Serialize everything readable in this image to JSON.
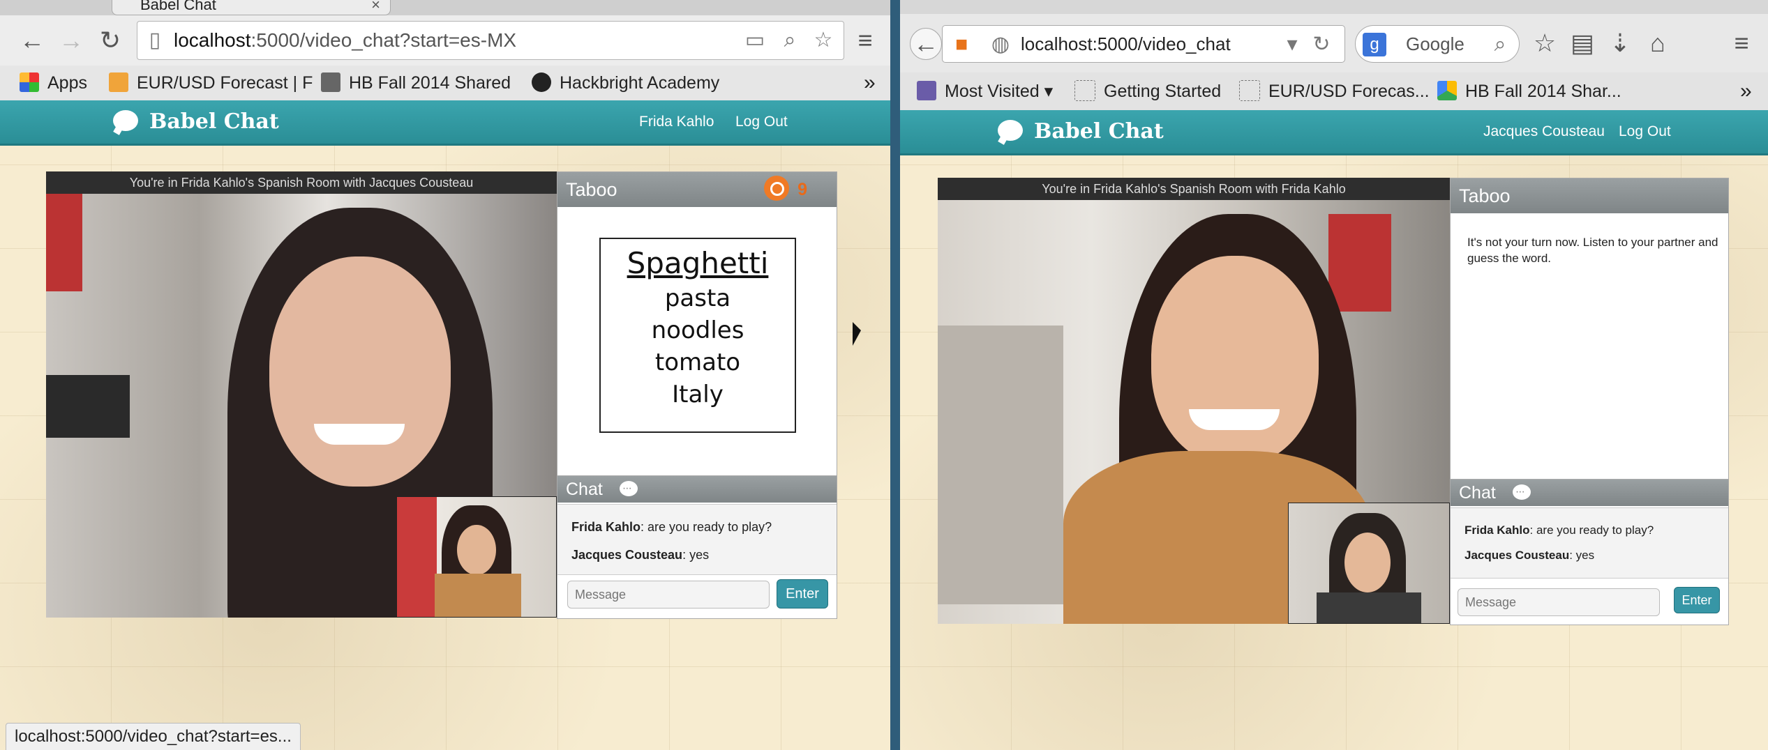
{
  "left": {
    "tab_title": "Babel Chat",
    "url_host": "localhost",
    "url_path": ":5000/video_chat?start=es-MX",
    "bookmarks": [
      "Apps",
      "EUR/USD Forecast | F",
      "HB Fall 2014 Shared",
      "Hackbright Academy"
    ],
    "bookmarks_overflow": "»",
    "app": {
      "logo": "Babel Chat",
      "user": "Frida Kahlo",
      "logout": "Log Out",
      "caption": "You're in Frida Kahlo's Spanish Room with Jacques Cousteau",
      "game_title": "Taboo",
      "timer": "9",
      "card": {
        "target": "Spaghetti",
        "taboo": [
          "pasta",
          "noodles",
          "tomato",
          "Italy"
        ]
      },
      "chat_title": "Chat",
      "messages": [
        {
          "author": "Frida Kahlo",
          "text": ": are you ready to play?"
        },
        {
          "author": "Jacques Cousteau",
          "text": ": yes"
        }
      ],
      "input_placeholder": "Message",
      "enter_label": "Enter"
    },
    "status": "localhost:5000/video_chat?start=es..."
  },
  "right": {
    "url": "localhost:5000/video_chat",
    "search_placeholder": "Google",
    "bookmarks": [
      "Most Visited",
      "Getting Started",
      "EUR/USD Forecas...",
      "HB Fall 2014 Shar..."
    ],
    "bookmarks_overflow": "»",
    "app": {
      "logo": "Babel Chat",
      "user": "Jacques Cousteau",
      "logout": "Log Out",
      "caption": "You're in Frida Kahlo's Spanish Room with Frida Kahlo",
      "game_title": "Taboo",
      "instructions": "It's not your turn now. Listen to your partner and guess the word.",
      "chat_title": "Chat",
      "messages": [
        {
          "author": "Frida Kahlo",
          "text": ": are you ready to play?"
        },
        {
          "author": "Jacques Cousteau",
          "text": ": yes"
        }
      ],
      "input_placeholder": "Message",
      "enter_label": "Enter"
    }
  },
  "colors": {
    "teal": "#2a8e96",
    "accent_orange": "#e86a1a",
    "map": "#f7ecd0"
  }
}
